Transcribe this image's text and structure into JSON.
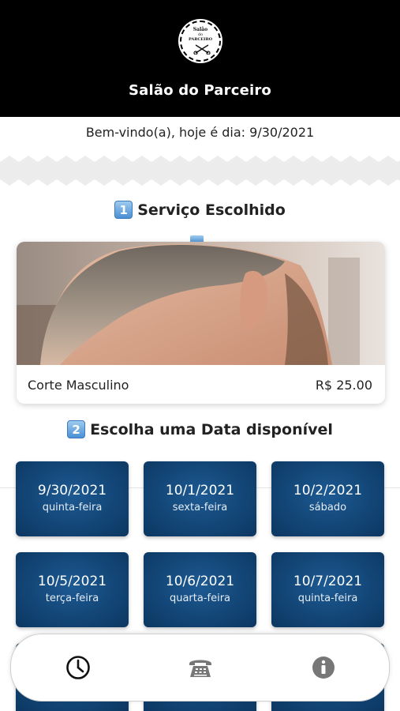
{
  "header": {
    "logo_line1": "Salão",
    "logo_line2": "do",
    "logo_line3": "PARCEIRO",
    "title": "Salão do Parceiro"
  },
  "welcome_text": "Bem-vindo(a), hoje é dia: 9/30/2021",
  "step1": {
    "badge": "1",
    "title": "Serviço Escolhido"
  },
  "service": {
    "name": "Corte Masculino",
    "price": "R$ 25.00"
  },
  "step2": {
    "badge": "2",
    "title": "Escolha uma Data disponível"
  },
  "dates": [
    {
      "date": "9/30/2021",
      "weekday": "quinta-feira"
    },
    {
      "date": "10/1/2021",
      "weekday": "sexta-feira"
    },
    {
      "date": "10/2/2021",
      "weekday": "sábado"
    },
    {
      "date": "10/5/2021",
      "weekday": "terça-feira"
    },
    {
      "date": "10/6/2021",
      "weekday": "quarta-feira"
    },
    {
      "date": "10/7/2021",
      "weekday": "quinta-feira"
    }
  ],
  "nav": [
    {
      "icon": "clock-icon"
    },
    {
      "icon": "phone-icon"
    },
    {
      "icon": "info-icon"
    }
  ],
  "colors": {
    "header_bg": "#000000",
    "date_card_bg": "#134677",
    "badge_blue": "#4a8fd4"
  }
}
